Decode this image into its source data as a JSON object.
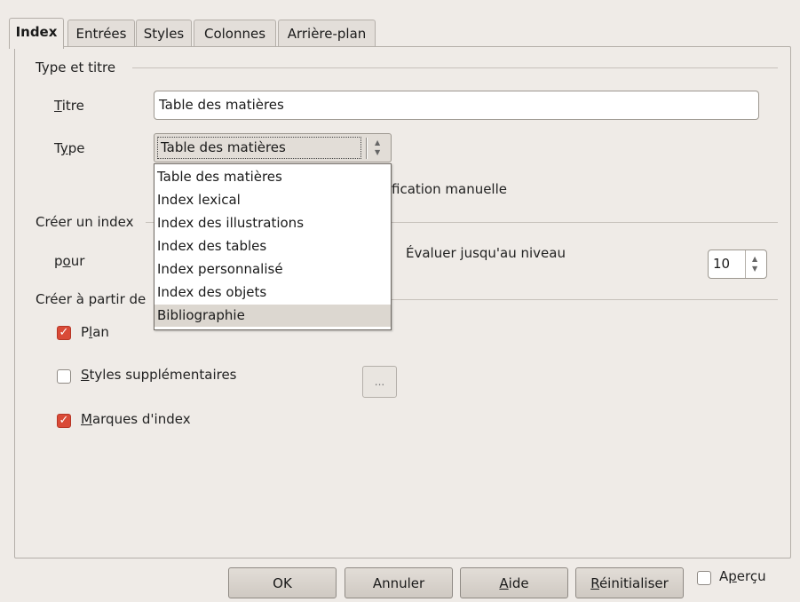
{
  "tabs": [
    {
      "label": "Index",
      "active": true
    },
    {
      "label": "Entrées",
      "active": false
    },
    {
      "label": "Styles",
      "active": false
    },
    {
      "label": "Colonnes",
      "active": false
    },
    {
      "label": "Arrière-plan",
      "active": false
    }
  ],
  "type_section": {
    "title": "Type et titre",
    "titre_label_u": "T",
    "titre_label_rest": "itre",
    "titre_value": "Table des matières",
    "type_label_a": "T",
    "type_label_u": "y",
    "type_label_b": "pe",
    "type_value": "Table des matières",
    "manual_partial": "fication manuelle"
  },
  "dropdown_options": [
    {
      "label": "Table des matières",
      "selected": false
    },
    {
      "label": "Index lexical",
      "selected": false
    },
    {
      "label": "Index des illustrations",
      "selected": false
    },
    {
      "label": "Index des tables",
      "selected": false
    },
    {
      "label": "Index personnalisé",
      "selected": false
    },
    {
      "label": "Index des objets",
      "selected": false
    },
    {
      "label": "Bibliographie",
      "selected": true
    }
  ],
  "create_section": {
    "title_partial": "Créer un index",
    "pour_a": "p",
    "pour_u": "o",
    "pour_b": "ur",
    "eval_a": "Évaluer ",
    "eval_u": "j",
    "eval_b": "usqu'au niveau",
    "level_value": "10"
  },
  "from_section": {
    "title_partial": "Créer à partir de",
    "plan_a": "P",
    "plan_u": "l",
    "plan_b": "an",
    "plan_checked": true,
    "styles_u": "S",
    "styles_b": "tyles supplémentaires",
    "styles_checked": false,
    "styles_button": "...",
    "marques_u": "M",
    "marques_b": "arques d'index",
    "marques_checked": true
  },
  "footer": {
    "ok": "OK",
    "cancel": "Annuler",
    "help_u": "A",
    "help_b": "ide",
    "reset_u": "R",
    "reset_b": "éinitialiser",
    "preview_a": "A",
    "preview_u": "p",
    "preview_b": "erçu",
    "preview_checked": false
  },
  "colors": {
    "window_bg": "#efebe7",
    "check_accent": "#d94a37",
    "selected_item_bg": "#dcd7d0"
  }
}
